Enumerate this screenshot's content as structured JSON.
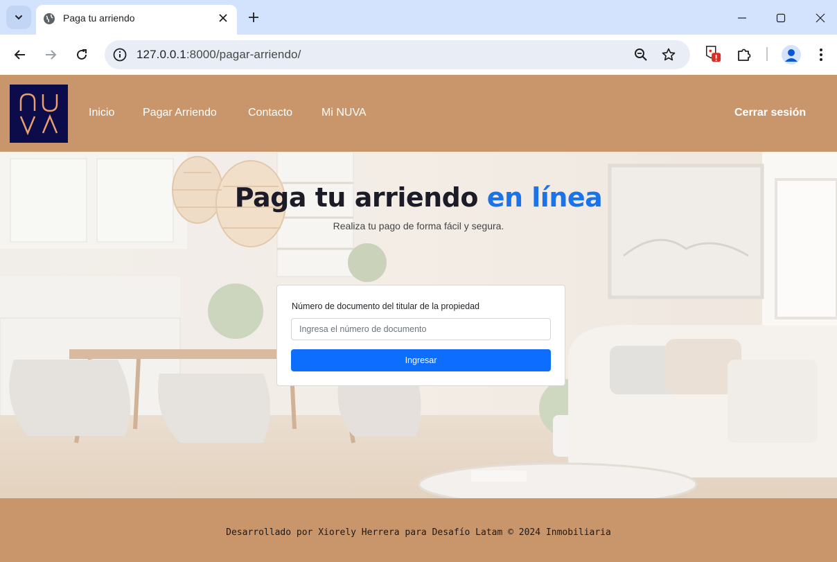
{
  "browser": {
    "tab_title": "Paga tu arriendo",
    "url_host": "127.0.0.1",
    "url_rest": ":8000/pagar-arriendo/"
  },
  "site": {
    "logo_line1": "NU",
    "logo_line2": "VA",
    "nav": [
      "Inicio",
      "Pagar Arriendo",
      "Contacto",
      "Mi NUVA"
    ],
    "logout": "Cerrar sesión"
  },
  "hero": {
    "title_main": "Paga tu arriendo",
    "title_accent": "en línea",
    "subtitle": "Realiza tu pago de forma fácil y segura."
  },
  "form": {
    "label": "Número de documento del titular de la propiedad",
    "placeholder": "Ingresa el número de documento",
    "submit": "Ingresar"
  },
  "footer": {
    "text": "Desarrollado por Xiorely Herrera para Desafío Latam © 2024 Inmobiliaria"
  },
  "colors": {
    "brand_tan": "#c8966a",
    "logo_navy": "#0d0c4a",
    "accent_blue": "#1a73e8",
    "button_blue": "#0d6efd"
  }
}
